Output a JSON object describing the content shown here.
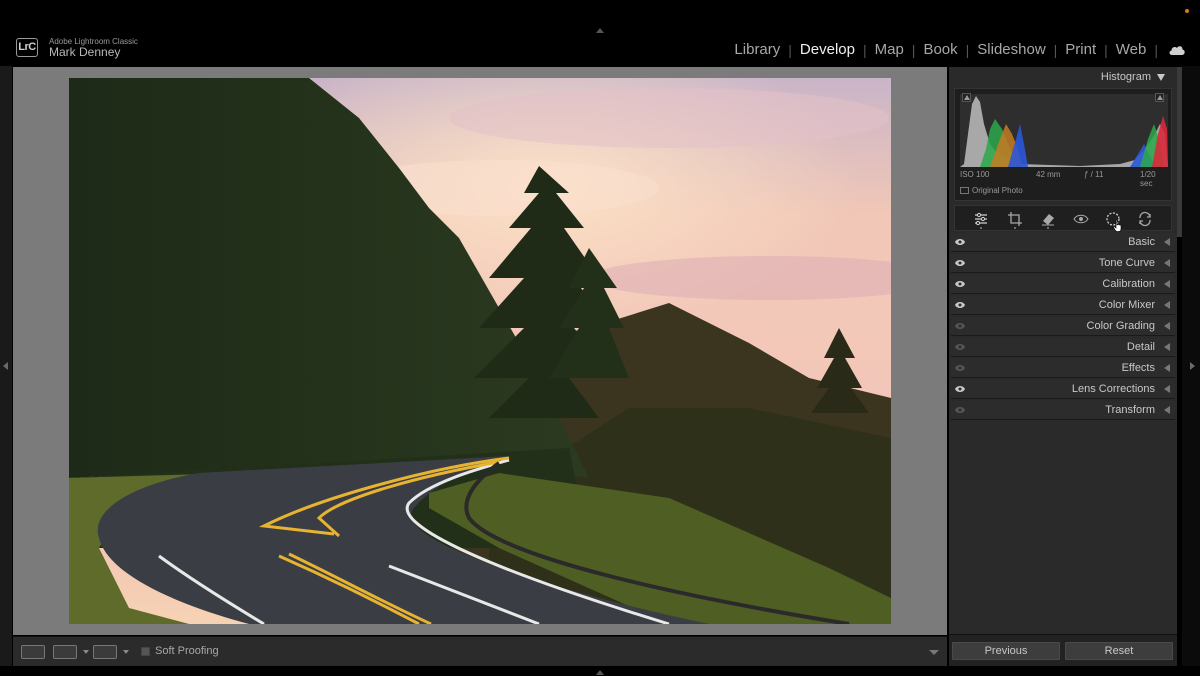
{
  "app": {
    "logo_text": "LrC",
    "app_name": "Adobe Lightroom Classic",
    "user_name": "Mark Denney"
  },
  "modules": [
    {
      "label": "Library",
      "active": false
    },
    {
      "label": "Develop",
      "active": true
    },
    {
      "label": "Map",
      "active": false
    },
    {
      "label": "Book",
      "active": false
    },
    {
      "label": "Slideshow",
      "active": false
    },
    {
      "label": "Print",
      "active": false
    },
    {
      "label": "Web",
      "active": false
    }
  ],
  "module_separator": "|",
  "histogram": {
    "title": "Histogram",
    "iso": "ISO 100",
    "focal_length": "42 mm",
    "aperture": "ƒ / 11",
    "shutter": "1/20 sec",
    "original_photo_label": "Original Photo"
  },
  "tools": [
    {
      "name": "edit-sliders-icon"
    },
    {
      "name": "crop-icon"
    },
    {
      "name": "healing-eraser-icon"
    },
    {
      "name": "red-eye-icon"
    },
    {
      "name": "masking-icon"
    },
    {
      "name": "presets-cycle-icon"
    }
  ],
  "panels": [
    {
      "label": "Basic",
      "eye_on": true
    },
    {
      "label": "Tone Curve",
      "eye_on": true
    },
    {
      "label": "Calibration",
      "eye_on": true
    },
    {
      "label": "Color Mixer",
      "eye_on": true
    },
    {
      "label": "Color Grading",
      "eye_on": false
    },
    {
      "label": "Detail",
      "eye_on": false
    },
    {
      "label": "Effects",
      "eye_on": false
    },
    {
      "label": "Lens Corrections",
      "eye_on": true
    },
    {
      "label": "Transform",
      "eye_on": false
    }
  ],
  "toolbar": {
    "soft_proofing_label": "Soft Proofing"
  },
  "buttons": {
    "previous": "Previous",
    "reset": "Reset"
  },
  "colors": {
    "accent_orange": "#d37a1f",
    "panel_bg": "#2a2a2a",
    "canvas_bg": "#7b7b7b"
  }
}
